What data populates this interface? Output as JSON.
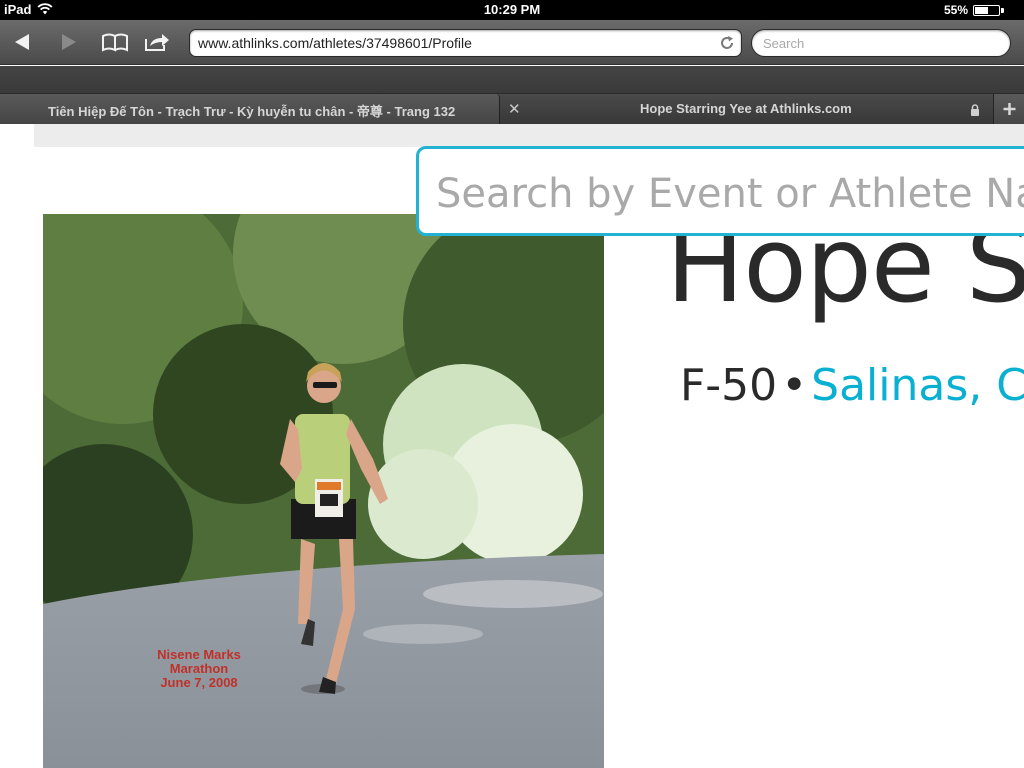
{
  "status_bar": {
    "device": "iPad",
    "time": "10:29 PM",
    "battery": "55%",
    "battery_level": 0.55
  },
  "toolbar": {
    "url": "www.athlinks.com/athletes/37498601/Profile",
    "search_placeholder": "Search"
  },
  "tabs": [
    {
      "label": "Tiên Hiệp Đế Tôn - Trạch Trư - Kỳ huyễn tu chân - 帝尊 - Trang 132",
      "active": false
    },
    {
      "label": "Hope Starring Yee at Athlinks.com",
      "active": true
    }
  ],
  "page": {
    "search_placeholder": "Search by Event or Athlete Name",
    "athlete_name": "Hope S",
    "age_group": "F-50",
    "separator": "•",
    "location": "Salinas, C",
    "photo_caption": [
      "Nisene Marks",
      "Marathon",
      "June 7, 2008"
    ]
  },
  "colors": {
    "accent": "#0ab0d2",
    "search_border": "#21b3d1"
  }
}
